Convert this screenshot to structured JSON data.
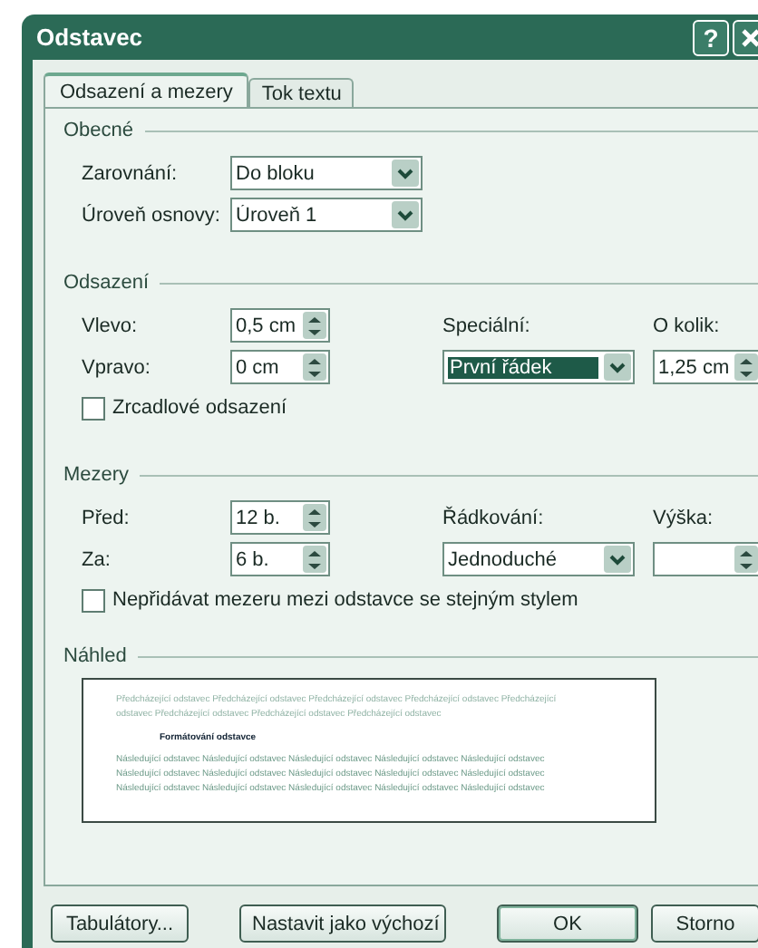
{
  "window": {
    "title": "Odstavec",
    "help": "?"
  },
  "tabs": [
    {
      "label": "Odsazení a mezery",
      "selected": true
    },
    {
      "label": "Tok textu",
      "selected": false
    }
  ],
  "general": {
    "title": "Obecné",
    "fields": [
      {
        "label": "Zarovnání:",
        "value": "Do bloku"
      },
      {
        "label": "Úroveň osnovy:",
        "value": "Úroveň 1"
      }
    ]
  },
  "indentation": {
    "title": "Odsazení",
    "left": {
      "label": "Vlevo:",
      "value": "0,5 cm"
    },
    "right": {
      "label": "Vpravo:",
      "value": "0 cm"
    },
    "special": {
      "label": "Speciální:",
      "value": "První řádek",
      "focused": true
    },
    "by": {
      "label": "O kolik:",
      "value": "1,25 cm"
    },
    "mirror": {
      "label": "Zrcadlové odsazení",
      "checked": false
    }
  },
  "spacing": {
    "title": "Mezery",
    "before": {
      "label": "Před:",
      "value": "12 b."
    },
    "after": {
      "label": "Za:",
      "value": "6 b."
    },
    "line_spacing": {
      "label": "Řádkování:",
      "value": "Jednoduché",
      "focused": false
    },
    "at": {
      "label": "Výška:"
    },
    "no_space": {
      "label": "Nepřidávat mezeru mezi odstavce se stejným stylem",
      "checked": false
    }
  },
  "preview": {
    "title": "Náhled",
    "previous": [
      "Předcházející odstavec Předcházející odstavec Předcházející odstavec Předcházející odstavec Předcházející",
      "odstavec Předcházející odstavec Předcházející odstavec Předcházející odstavec"
    ],
    "current": "Formátování odstavce",
    "following": [
      "Následující odstavec Následující odstavec Následující odstavec Následující odstavec Následující odstavec",
      "Následující odstavec Následující odstavec Následující odstavec Následující odstavec Následující odstavec",
      "Následující odstavec Následující odstavec Následující odstavec Následující odstavec Následující odstavec"
    ]
  },
  "buttons": [
    {
      "label": "Tabulátory...",
      "default": false
    },
    {
      "label": "Nastavit jako výchozí",
      "default": false
    },
    {
      "label": "OK",
      "default": true
    },
    {
      "label": "Storno",
      "default": false
    }
  ]
}
